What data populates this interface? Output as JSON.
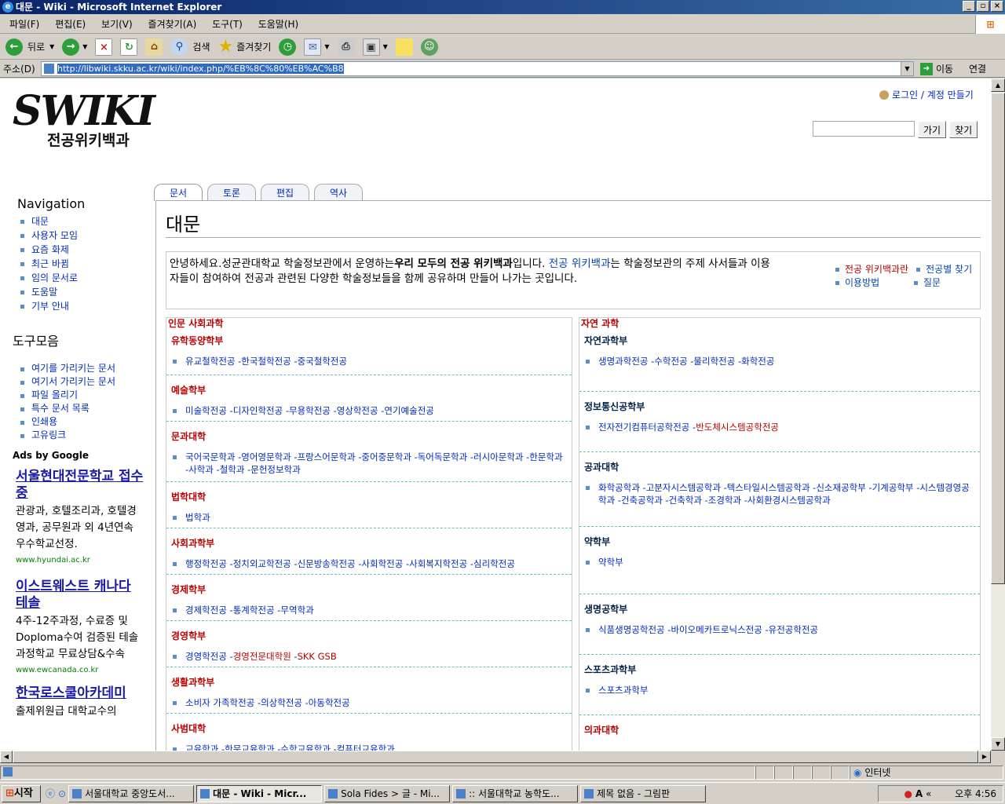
{
  "window": {
    "title": "대문 - Wiki - Microsoft Internet Explorer",
    "controls": [
      "_",
      "▫",
      "×"
    ]
  },
  "menu": [
    "파일(F)",
    "편집(E)",
    "보기(V)",
    "즐겨찾기(A)",
    "도구(T)",
    "도움말(H)"
  ],
  "toolbar": {
    "back": "뒤로",
    "search": "검색",
    "favorites": "즐겨찾기"
  },
  "address": {
    "label": "주소(D)",
    "url": "http://libwiki.skku.ac.kr/wiki/index.php/%EB%8C%80%EB%AC%B8",
    "go": "이동",
    "links": "연결"
  },
  "wiki": {
    "logo_main": "SWIKI",
    "logo_sub": "전공위키백과",
    "personal": "로그인 / 계정 만들기",
    "search_go": "가기",
    "search_find": "찾기",
    "nav_heading": "Navigation",
    "nav_items": [
      "대문",
      "사용자 모임",
      "요즘 화제",
      "최근 바뀜",
      "임의 문서로",
      "도움말",
      "기부 안내"
    ],
    "tools_heading": "도구모음",
    "tools_items": [
      "여기를 가리키는 문서",
      "여기서 가리키는 문서",
      "파일 올리기",
      "특수 문서 목록",
      "인쇄용",
      "고유링크"
    ],
    "ads_heading": "Ads by Google",
    "ads": [
      {
        "title": "서울현대전문학교 접수중",
        "desc": "관광과, 호텔조리과, 호텔경영과, 공무원과 외 4년연속 우수학교선정.",
        "url": "www.hyundai.ac.kr"
      },
      {
        "title": "이스트웨스트 캐나다 테솔",
        "desc": "4주-12주과정, 수료증 및 Doploma수여 검증된 테솔과정학교 무료상담&수속",
        "url": "www.ewcanada.co.kr"
      },
      {
        "title": "한국로스쿨아카데미",
        "desc": "출제위원급 대학교수의",
        "url": ""
      }
    ],
    "tabs": [
      "문서",
      "토론",
      "편집",
      "역사"
    ],
    "heading": "대문",
    "intro": {
      "p1": "안녕하세요.성균관대학교 학술정보관에서 운영하는",
      "bold": "우리 모두의 전공 위키백과",
      "p2": "입니다. ",
      "link": "전공 위키백과",
      "p3": "는 학술정보관의 주제 사서들과 이용자들이 참여하여 전공과 관련된 다양한 학술정보들을 함께 공유하며 만들어 나가는 곳입니다.",
      "links": [
        "전공 위키백과란",
        "전공별 찾기",
        "이용방법",
        "질문"
      ]
    },
    "left_col": {
      "heading": "인문 사회과학",
      "sections": [
        {
          "title": "유학동양학부",
          "items": "유교철학전공 -한국철학전공 -중국철학전공"
        },
        {
          "title": "예술학부",
          "items": "미술학전공 -디자인학전공 -무용학전공 -영상학전공 -연기예술전공"
        },
        {
          "title": "문과대학",
          "items": "국어국문학과 -영어영문학과 -프랑스어문학과 -중어중문학과 -독어독문학과 -러시아문학과 -한문학과 -사학과 -철학과 -문헌정보학과"
        },
        {
          "title": "법학대학",
          "items": "법학과"
        },
        {
          "title": "사회과학부",
          "items": "행정학전공 -정치외교학전공 -신문방송학전공 -사회학전공 -사회복지학전공 -심리학전공"
        },
        {
          "title": "경제학부",
          "items": "경제학전공 -통계학전공 -무역학과"
        },
        {
          "title": "경영학부",
          "items": "경영학전공 -",
          "red1": "경영전문대학원",
          "mid": " -",
          "red2": "SKK GSB"
        },
        {
          "title": "생활과학부",
          "items": "소비자 가족학전공 -의상학전공 -아동학전공"
        },
        {
          "title": "사범대학",
          "items": "교육학과 -한문교육학과 -수학교육학과 -컴퓨터교육학과"
        }
      ]
    },
    "right_col": {
      "heading": "자연 과학",
      "sections": [
        {
          "title": "자연과학부",
          "items": "생명과학전공 -수학전공 -물리학전공 -화학전공"
        },
        {
          "title": "정보통신공학부",
          "items": "전자전기컴퓨터공학전공 -",
          "red1": "반도체시스템공학전공"
        },
        {
          "title": "공과대학",
          "items": "화학공학과 -고분자시스템공학과 -텍스타일시스템공학과 -신소재공학부 -기계공학부 -시스템경영공학과 -건축공학과 -건축학과 -조경학과 -사회환경시스템공학과"
        },
        {
          "title": "약학부",
          "items": "약학부"
        },
        {
          "title": "생명공학부",
          "items": "식품생명공학전공 -바이오메카트로닉스전공 -유전공학전공"
        },
        {
          "title": "스포츠과학부",
          "items": "스포츠과학부"
        },
        {
          "title": "의과대학",
          "items": ""
        }
      ]
    }
  },
  "status": {
    "zone": "인터넷"
  },
  "taskbar": {
    "start": "시작",
    "tasks": [
      "서울대학교 중앙도서...",
      "대문 - Wiki - Micr...",
      "Sola Fides > 글 - Mi...",
      ":: 서울대학교 농학도...",
      "제목 없음 - 그림판"
    ],
    "time": "오후 4:56"
  }
}
